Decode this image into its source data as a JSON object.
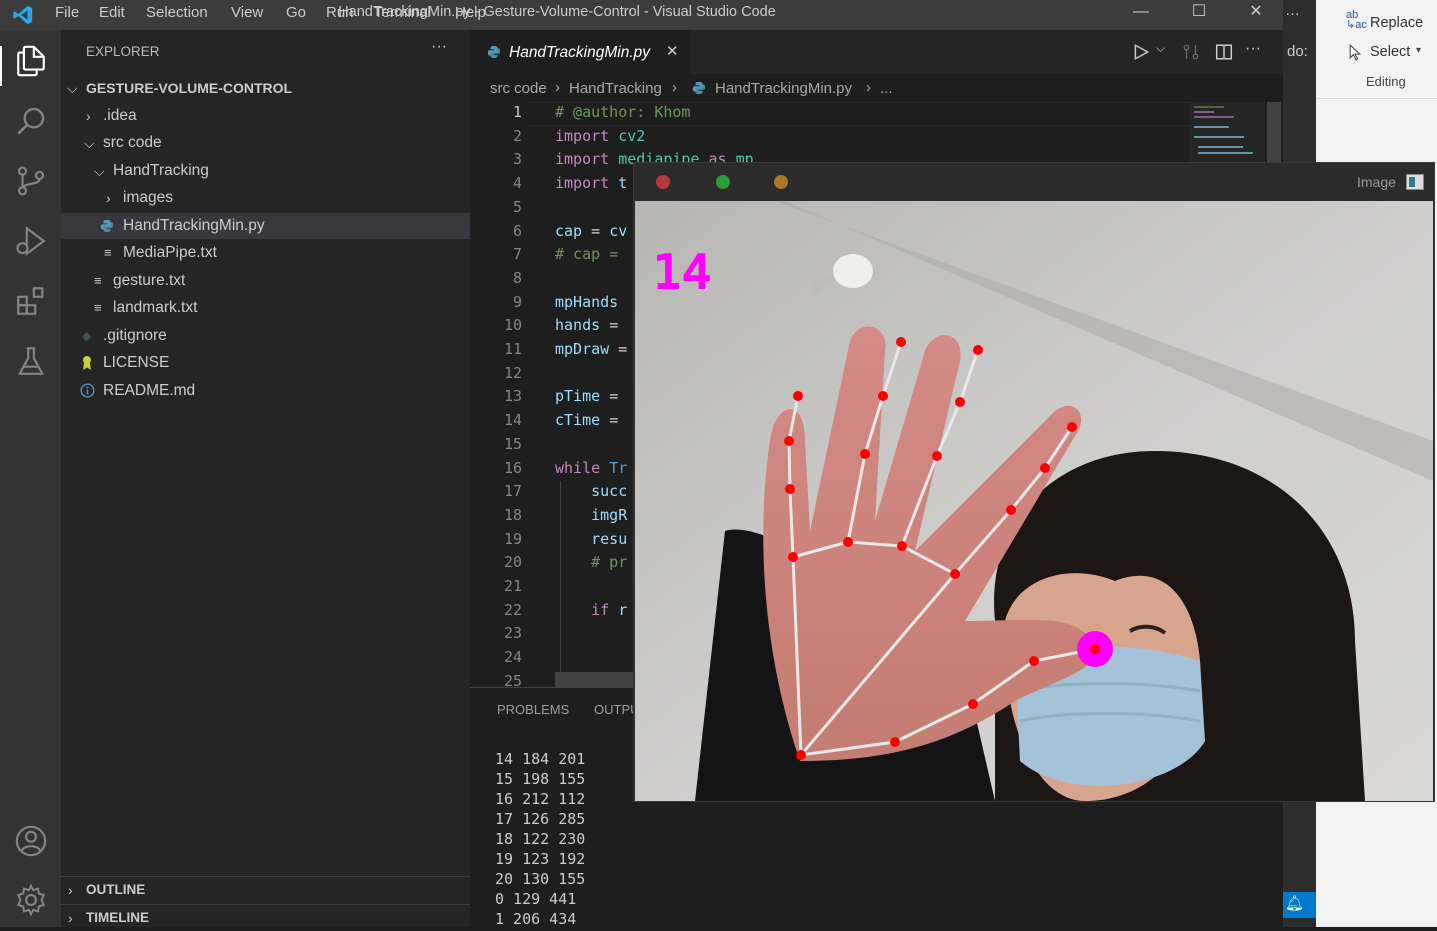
{
  "titlebar": {
    "menu": [
      "File",
      "Edit",
      "Selection",
      "View",
      "Go",
      "Run",
      "Terminal",
      "Help"
    ],
    "title": "HandTrackingMin.py - Gesture-Volume-Control - Visual Studio Code",
    "minimize": "—",
    "maximize": "☐",
    "close": "✕",
    "overflow": "…"
  },
  "activity_bar": {
    "icons": [
      "explorer-icon",
      "search-icon",
      "source-control-icon",
      "run-debug-icon",
      "extensions-icon",
      "testing-icon",
      "account-icon",
      "settings-gear-icon"
    ]
  },
  "sidebar": {
    "header": "EXPLORER",
    "more": "···",
    "root": "GESTURE-VOLUME-CONTROL",
    "items": [
      {
        "label": ".idea",
        "kind": "folder-collapsed"
      },
      {
        "label": "src code",
        "kind": "folder-expanded"
      },
      {
        "label": "HandTracking",
        "kind": "folder-expanded"
      },
      {
        "label": "images",
        "kind": "folder-collapsed"
      },
      {
        "label": "HandTrackingMin.py",
        "kind": "python",
        "selected": true
      },
      {
        "label": "MediaPipe.txt",
        "kind": "text"
      },
      {
        "label": "gesture.txt",
        "kind": "text"
      },
      {
        "label": "landmark.txt",
        "kind": "text"
      },
      {
        "label": ".gitignore",
        "kind": "git"
      },
      {
        "label": "LICENSE",
        "kind": "license"
      },
      {
        "label": "README.md",
        "kind": "info"
      }
    ],
    "outline": "OUTLINE",
    "timeline": "TIMELINE"
  },
  "editor": {
    "tab_label": "HandTrackingMin.py",
    "tab_close": "✕",
    "breadcrumb": [
      "src code",
      "HandTracking",
      "HandTrackingMin.py",
      "..."
    ],
    "line_numbers": [
      "1",
      "2",
      "3",
      "4",
      "5",
      "6",
      "7",
      "8",
      "9",
      "10",
      "11",
      "12",
      "13",
      "14",
      "15",
      "16",
      "17",
      "18",
      "19",
      "20",
      "21",
      "22",
      "23",
      "24",
      "25"
    ],
    "lines": [
      "# @author: Khom",
      "import cv2",
      "import mediapipe as mp",
      "import t",
      "",
      "cap = cv",
      "# cap = ",
      "",
      "mpHands ",
      "hands = ",
      "mpDraw =",
      "",
      "pTime = ",
      "cTime = ",
      "",
      "while Tr",
      "    succ",
      "    imgR",
      "    resu",
      "    # pr",
      "",
      "    if r",
      "",
      "",
      ""
    ]
  },
  "panel": {
    "tabs": [
      "PROBLEMS",
      "OUTPU"
    ],
    "terminal_lines": [
      "14 184 201",
      "15 198 155",
      "16 212 112",
      "17 126 285",
      "18 122 230",
      "19 123 192",
      "20 130 155",
      "0 129 441",
      "1 206 434"
    ]
  },
  "word_ribbon": {
    "replace": "Replace",
    "select": "Select",
    "group": "Editing",
    "partial": "do:"
  },
  "image_window": {
    "title": "Image",
    "overlay_number": "14"
  },
  "colors": {
    "accent": "#007acc",
    "landmark": "#ff0000",
    "highlight": "#ff00ff"
  }
}
